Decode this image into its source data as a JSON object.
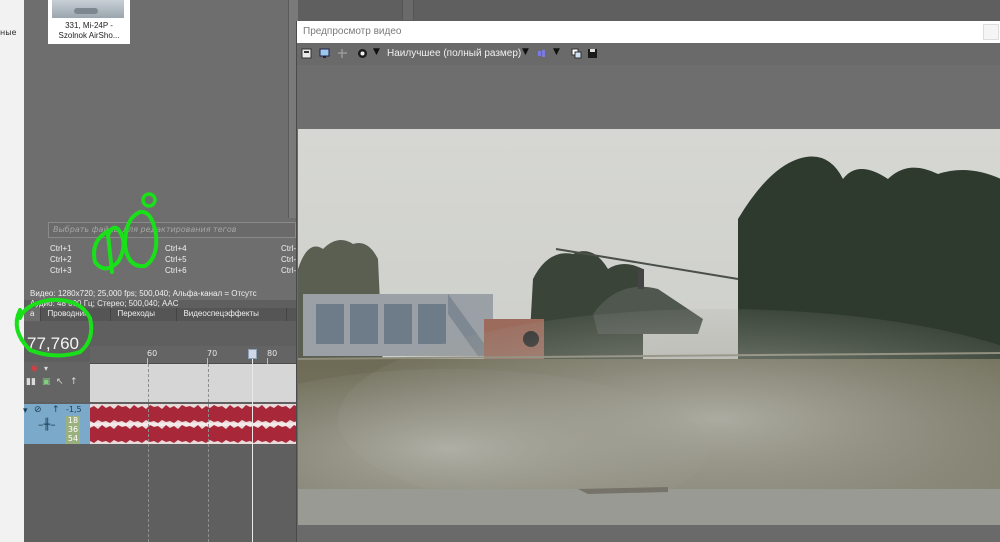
{
  "explorer": {
    "left_label": "ные",
    "thumbnail_caption_1": "331, Mi-24P -",
    "thumbnail_caption_2": "Szolnok AirSho...",
    "tag_placeholder": "Выбрать файлы для редактирования тегов",
    "shortcuts": [
      {
        "label": "Ctrl+1"
      },
      {
        "label": "Ctrl+2"
      },
      {
        "label": "Ctrl+3"
      },
      {
        "label": "Ctrl+4"
      },
      {
        "label": "Ctrl+5"
      },
      {
        "label": "Ctrl+6"
      },
      {
        "label": "Ctrl-"
      },
      {
        "label": "Ctrl-"
      },
      {
        "label": "Ctrl-"
      }
    ],
    "info_video": "Видео: 1280x720; 25,000 fps; 500,040; Альфа-канал = Отсутс",
    "info_audio": "Аудио: 48 000 Гц; Стерео; 500,040; AAC"
  },
  "tabs": [
    {
      "label": "а"
    },
    {
      "label": "Проводник"
    },
    {
      "label": "Переходы"
    },
    {
      "label": "Видеоспецэффекты"
    }
  ],
  "timeline": {
    "timecode": "77,760",
    "ruler_labels": [
      "60",
      "70",
      "80"
    ],
    "volume_db": "-1,5",
    "level_values": [
      "18",
      "36",
      "54"
    ]
  },
  "preview": {
    "title": "Предпросмотр видео",
    "quality": "Наилучшее (полный размер)"
  },
  "colors": {
    "waveform": "#a8283a",
    "annotation": "#19e019",
    "audio_header": "#7aa9c9"
  }
}
